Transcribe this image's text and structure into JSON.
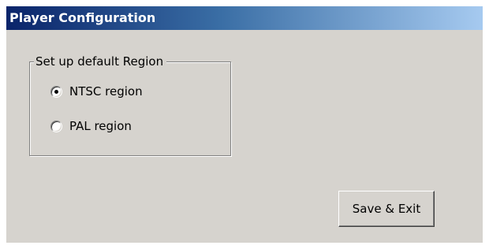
{
  "window": {
    "title": "Player Configuration"
  },
  "region_group": {
    "legend": "Set up default Region",
    "options": [
      {
        "label": "NTSC region",
        "selected": true
      },
      {
        "label": "PAL region",
        "selected": false
      }
    ]
  },
  "actions": {
    "save_exit_label": "Save & Exit"
  },
  "colors": {
    "window_face": "#d6d3ce",
    "title_gradient_start": "#0a246a",
    "title_gradient_end": "#a6caf0",
    "title_text": "#ffffff"
  }
}
